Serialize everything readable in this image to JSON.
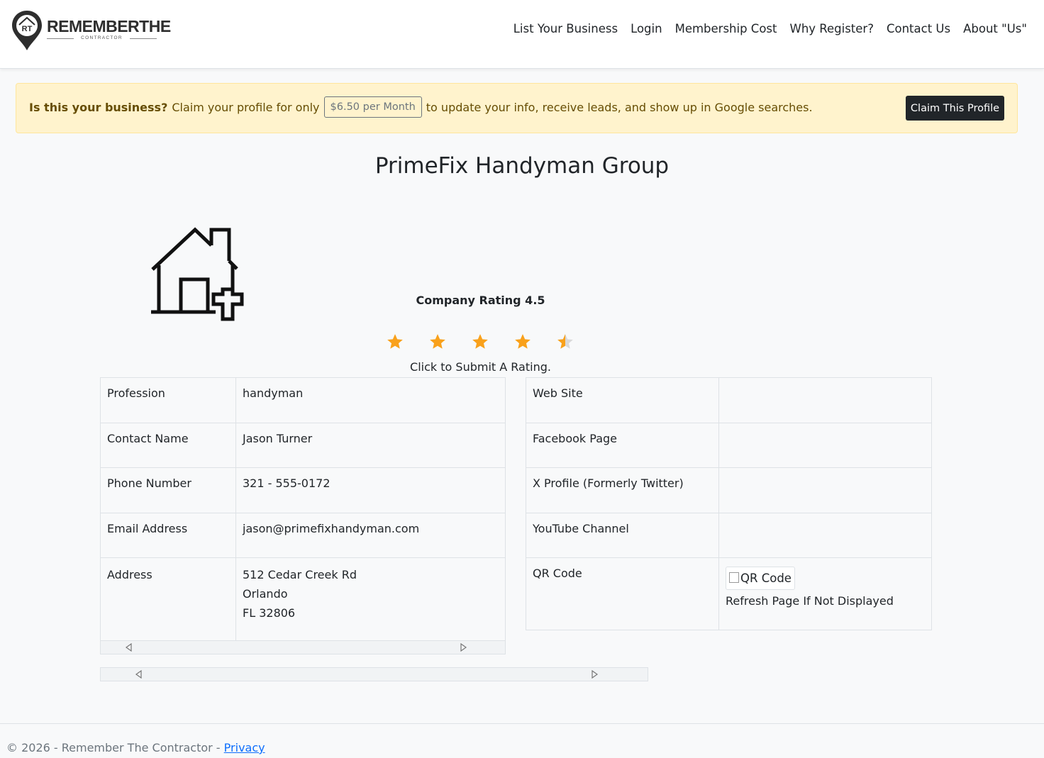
{
  "header": {
    "brand_name": "REMEMBERTHE",
    "brand_sub": "CONTRACTOR",
    "logo_initials": "RT",
    "nav": [
      {
        "label": "List Your Business"
      },
      {
        "label": "Login"
      },
      {
        "label": "Membership Cost"
      },
      {
        "label": "Why Register?"
      },
      {
        "label": "Contact Us"
      },
      {
        "label": "About \"Us\""
      }
    ]
  },
  "claim_banner": {
    "question": "Is this your business?",
    "lead": "Claim your profile for only",
    "price": "$6.50 per Month",
    "tail": "to update your info, receive leads, and show up in Google searches.",
    "button_label": "Claim This Profile"
  },
  "company": {
    "name": "PrimeFix Handyman Group",
    "icon": "house-plus-icon"
  },
  "rating": {
    "label": "Company Rating 4.5",
    "value": 4.5,
    "max": 5,
    "hint": "Click to Submit A Rating.",
    "star_color": "#f9a11b",
    "star_empty_color": "#d9d9d9"
  },
  "details_left": {
    "rows": [
      {
        "label": "Profession",
        "value": "handyman"
      },
      {
        "label": "Contact Name",
        "value": "Jason Turner"
      },
      {
        "label": "Phone Number",
        "value": "321 - 555-0172"
      },
      {
        "label": "Email Address",
        "value": "jason@primefixhandyman.com"
      }
    ],
    "address": {
      "label": "Address",
      "line1": "512 Cedar Creek Rd",
      "line2": "Orlando",
      "line3": "FL 32806"
    }
  },
  "details_right": {
    "rows": [
      {
        "label": "Web Site",
        "value": ""
      },
      {
        "label": "Facebook Page",
        "value": ""
      },
      {
        "label": "X Profile (Formerly Twitter)",
        "value": ""
      },
      {
        "label": "YouTube Channel",
        "value": ""
      }
    ],
    "qr": {
      "label": "QR Code",
      "alt": "QR Code",
      "note": "Refresh Page If Not Displayed"
    }
  },
  "footer": {
    "text": "© 2026 - Remember The Contractor -",
    "link": "Privacy"
  }
}
